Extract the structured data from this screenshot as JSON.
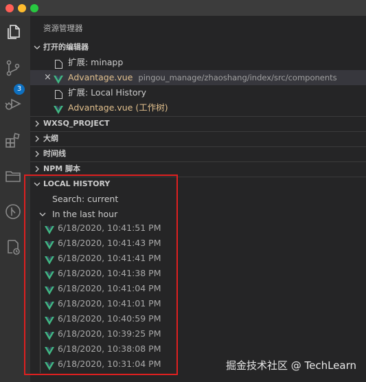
{
  "window": {
    "traffic_lights": [
      "close",
      "minimize",
      "maximize"
    ]
  },
  "activity_bar": {
    "items": [
      {
        "icon": "files-icon"
      },
      {
        "icon": "source-control-icon",
        "badge": "3"
      },
      {
        "icon": "run-debug-icon"
      },
      {
        "icon": "extensions-icon"
      },
      {
        "icon": "folder-icon"
      },
      {
        "icon": "git-graph-icon"
      },
      {
        "icon": "history-file-icon"
      }
    ]
  },
  "explorer": {
    "title": "资源管理器",
    "open_editors": {
      "header": "打开的编辑器",
      "items": [
        {
          "label": "扩展: minapp",
          "icon": "file-icon"
        },
        {
          "label": "Advantage.vue",
          "description": "pingou_manage/zhaoshang/index/src/components",
          "icon": "vue-icon",
          "close": "×"
        },
        {
          "label": "扩展: Local History",
          "icon": "file-icon"
        },
        {
          "label": "Advantage.vue (工作树)",
          "icon": "vue-icon"
        }
      ]
    },
    "sections": [
      {
        "label": "WXSQ_PROJECT"
      },
      {
        "label": "大纲"
      },
      {
        "label": "时间线"
      },
      {
        "label": "NPM 脚本"
      }
    ],
    "local_history": {
      "header": "LOCAL HISTORY",
      "search": "Search: current",
      "group": "In the last hour",
      "entries": [
        "6/18/2020, 10:41:51 PM",
        "6/18/2020, 10:41:43 PM",
        "6/18/2020, 10:41:41 PM",
        "6/18/2020, 10:41:38 PM",
        "6/18/2020, 10:41:04 PM",
        "6/18/2020, 10:41:01 PM",
        "6/18/2020, 10:40:59 PM",
        "6/18/2020, 10:39:25 PM",
        "6/18/2020, 10:38:08 PM",
        "6/18/2020, 10:31:04 PM"
      ]
    }
  },
  "watermark": "掘金技术社区 @ TechLearn",
  "colors": {
    "accent_vue": "#41b883",
    "badge": "#0e70c0",
    "annotation": "#e02020"
  }
}
